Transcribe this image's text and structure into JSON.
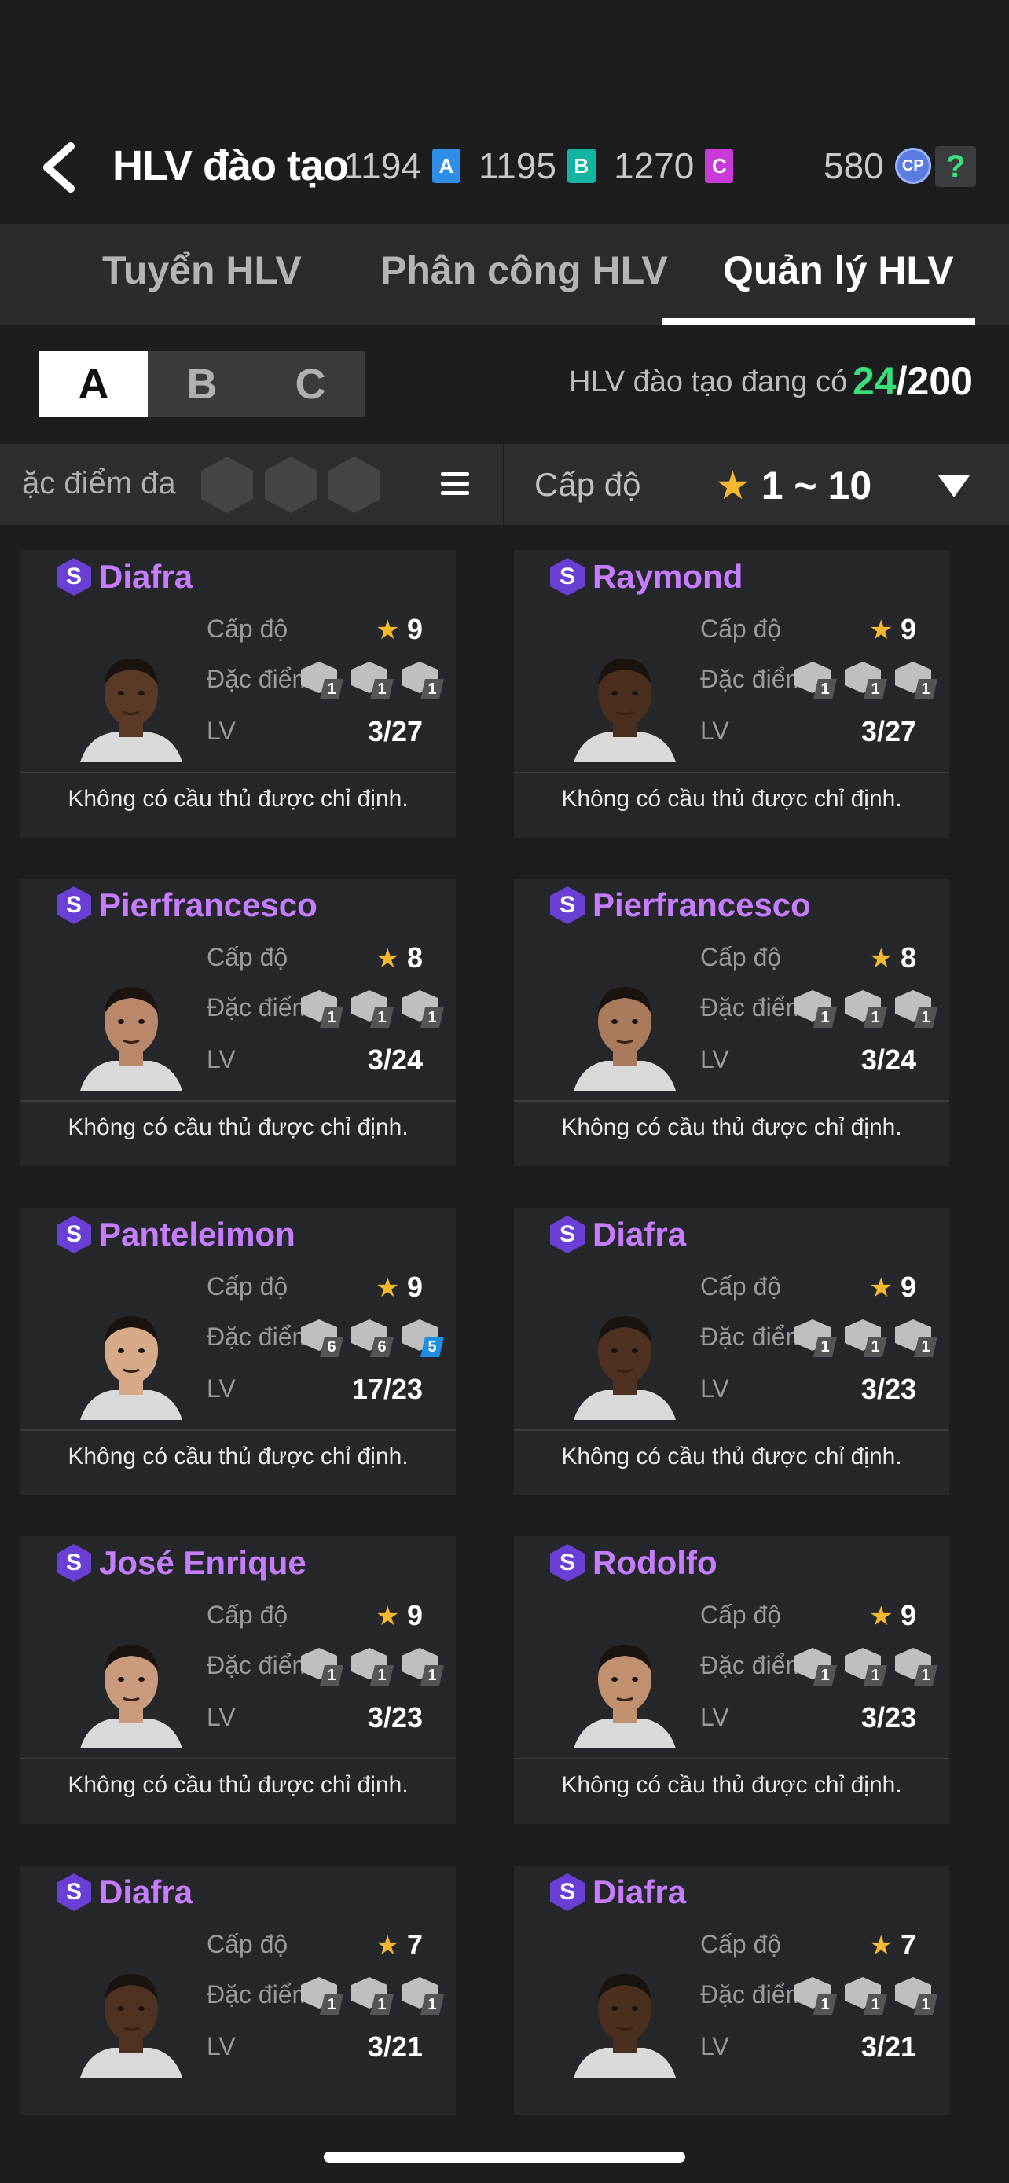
{
  "header": {
    "title": "HLV đào tạo",
    "currencies": [
      {
        "value": "1194",
        "token": "A",
        "color": "#2f8fe8"
      },
      {
        "value": "1195",
        "token": "B",
        "color": "#13b4a0"
      },
      {
        "value": "1270",
        "token": "C",
        "color": "#c93ad6"
      }
    ],
    "cp_value": "580",
    "cp_label": "CP",
    "help": "?"
  },
  "tabs": [
    {
      "label": "Tuyển HLV"
    },
    {
      "label": "Phân công HLV"
    },
    {
      "label": "Quản lý HLV"
    }
  ],
  "grade_filter": {
    "options": [
      "A",
      "B",
      "C"
    ],
    "selected": "A"
  },
  "count": {
    "label": "HLV đào tạo đang có",
    "current": "24",
    "max": "/200"
  },
  "filter_bar": {
    "trait_label": "ặc điểm đa",
    "level_label": "Cấp độ",
    "level_star": "★",
    "level_range": " 1 ~ 10"
  },
  "card_labels": {
    "level": "Cấp độ",
    "traits": "Đặc điểm",
    "lv": "LV",
    "star": "★ ",
    "no_player": "Không có cầu thủ được chỉ định.",
    "badge": "S"
  },
  "coaches": [
    {
      "name": "Diafra",
      "level": "9",
      "lv": "3/27",
      "traits": [
        {
          "n": "1"
        },
        {
          "n": "1"
        },
        {
          "n": "1"
        }
      ],
      "skin": "#5a3a26"
    },
    {
      "name": "Raymond",
      "level": "9",
      "lv": "3/27",
      "traits": [
        {
          "n": "1"
        },
        {
          "n": "1"
        },
        {
          "n": "1"
        }
      ],
      "skin": "#4a2e1e"
    },
    {
      "name": "Pierfrancesco",
      "level": "8",
      "lv": "3/24",
      "traits": [
        {
          "n": "1"
        },
        {
          "n": "1"
        },
        {
          "n": "1"
        }
      ],
      "skin": "#b9876a"
    },
    {
      "name": "Pierfrancesco",
      "level": "8",
      "lv": "3/24",
      "traits": [
        {
          "n": "1"
        },
        {
          "n": "1"
        },
        {
          "n": "1"
        }
      ],
      "skin": "#a97a5c"
    },
    {
      "name": "Panteleimon",
      "level": "9",
      "lv": "17/23",
      "traits": [
        {
          "n": "6"
        },
        {
          "n": "6"
        },
        {
          "n": "5",
          "blue": true
        }
      ],
      "skin": "#d6a988"
    },
    {
      "name": "Diafra",
      "level": "9",
      "lv": "3/23",
      "traits": [
        {
          "n": "1"
        },
        {
          "n": "1"
        },
        {
          "n": "1"
        }
      ],
      "skin": "#4e3120"
    },
    {
      "name": "José Enrique",
      "level": "9",
      "lv": "3/23",
      "traits": [
        {
          "n": "1"
        },
        {
          "n": "1"
        },
        {
          "n": "1"
        }
      ],
      "skin": "#c99a7c"
    },
    {
      "name": "Rodolfo",
      "level": "9",
      "lv": "3/23",
      "traits": [
        {
          "n": "1"
        },
        {
          "n": "1"
        },
        {
          "n": "1"
        }
      ],
      "skin": "#c1906f"
    },
    {
      "name": "Diafra",
      "level": "7",
      "lv": "3/21",
      "traits": [
        {
          "n": "1"
        },
        {
          "n": "1"
        },
        {
          "n": "1"
        }
      ],
      "skin": "#4f3222"
    },
    {
      "name": "Diafra",
      "level": "7",
      "lv": "3/21",
      "traits": [
        {
          "n": "1"
        },
        {
          "n": "1"
        },
        {
          "n": "1"
        }
      ],
      "skin": "#4b2f1f"
    }
  ],
  "icons": {
    "back": "chevron-left-icon",
    "menu": "hamburger-menu-icon",
    "dropdown": "caret-down-icon"
  }
}
